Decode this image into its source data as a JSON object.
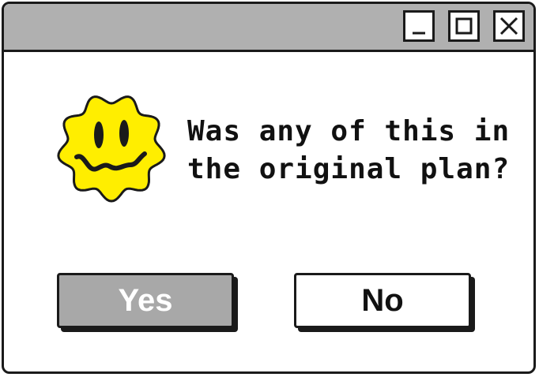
{
  "dialog": {
    "title_bar": {
      "buttons": [
        {
          "name": "minimize",
          "icon": "minimize-icon"
        },
        {
          "name": "maximize",
          "icon": "maximize-icon"
        },
        {
          "name": "close",
          "icon": "close-icon"
        }
      ]
    },
    "icon": "wavy-smiley-face-icon",
    "message_lines": [
      "Was any of this in",
      "the original plan?"
    ],
    "buttons": {
      "yes_label": "Yes",
      "no_label": "No"
    }
  },
  "colors": {
    "titlebar": "#b0b0b0",
    "window_bg": "#ffffff",
    "border": "#1a1a1a",
    "smiley_fill": "#ffee00",
    "yes_button_bg": "#a8a8a8",
    "yes_button_text": "#ffffff",
    "no_button_bg": "#ffffff",
    "no_button_text": "#111111"
  }
}
